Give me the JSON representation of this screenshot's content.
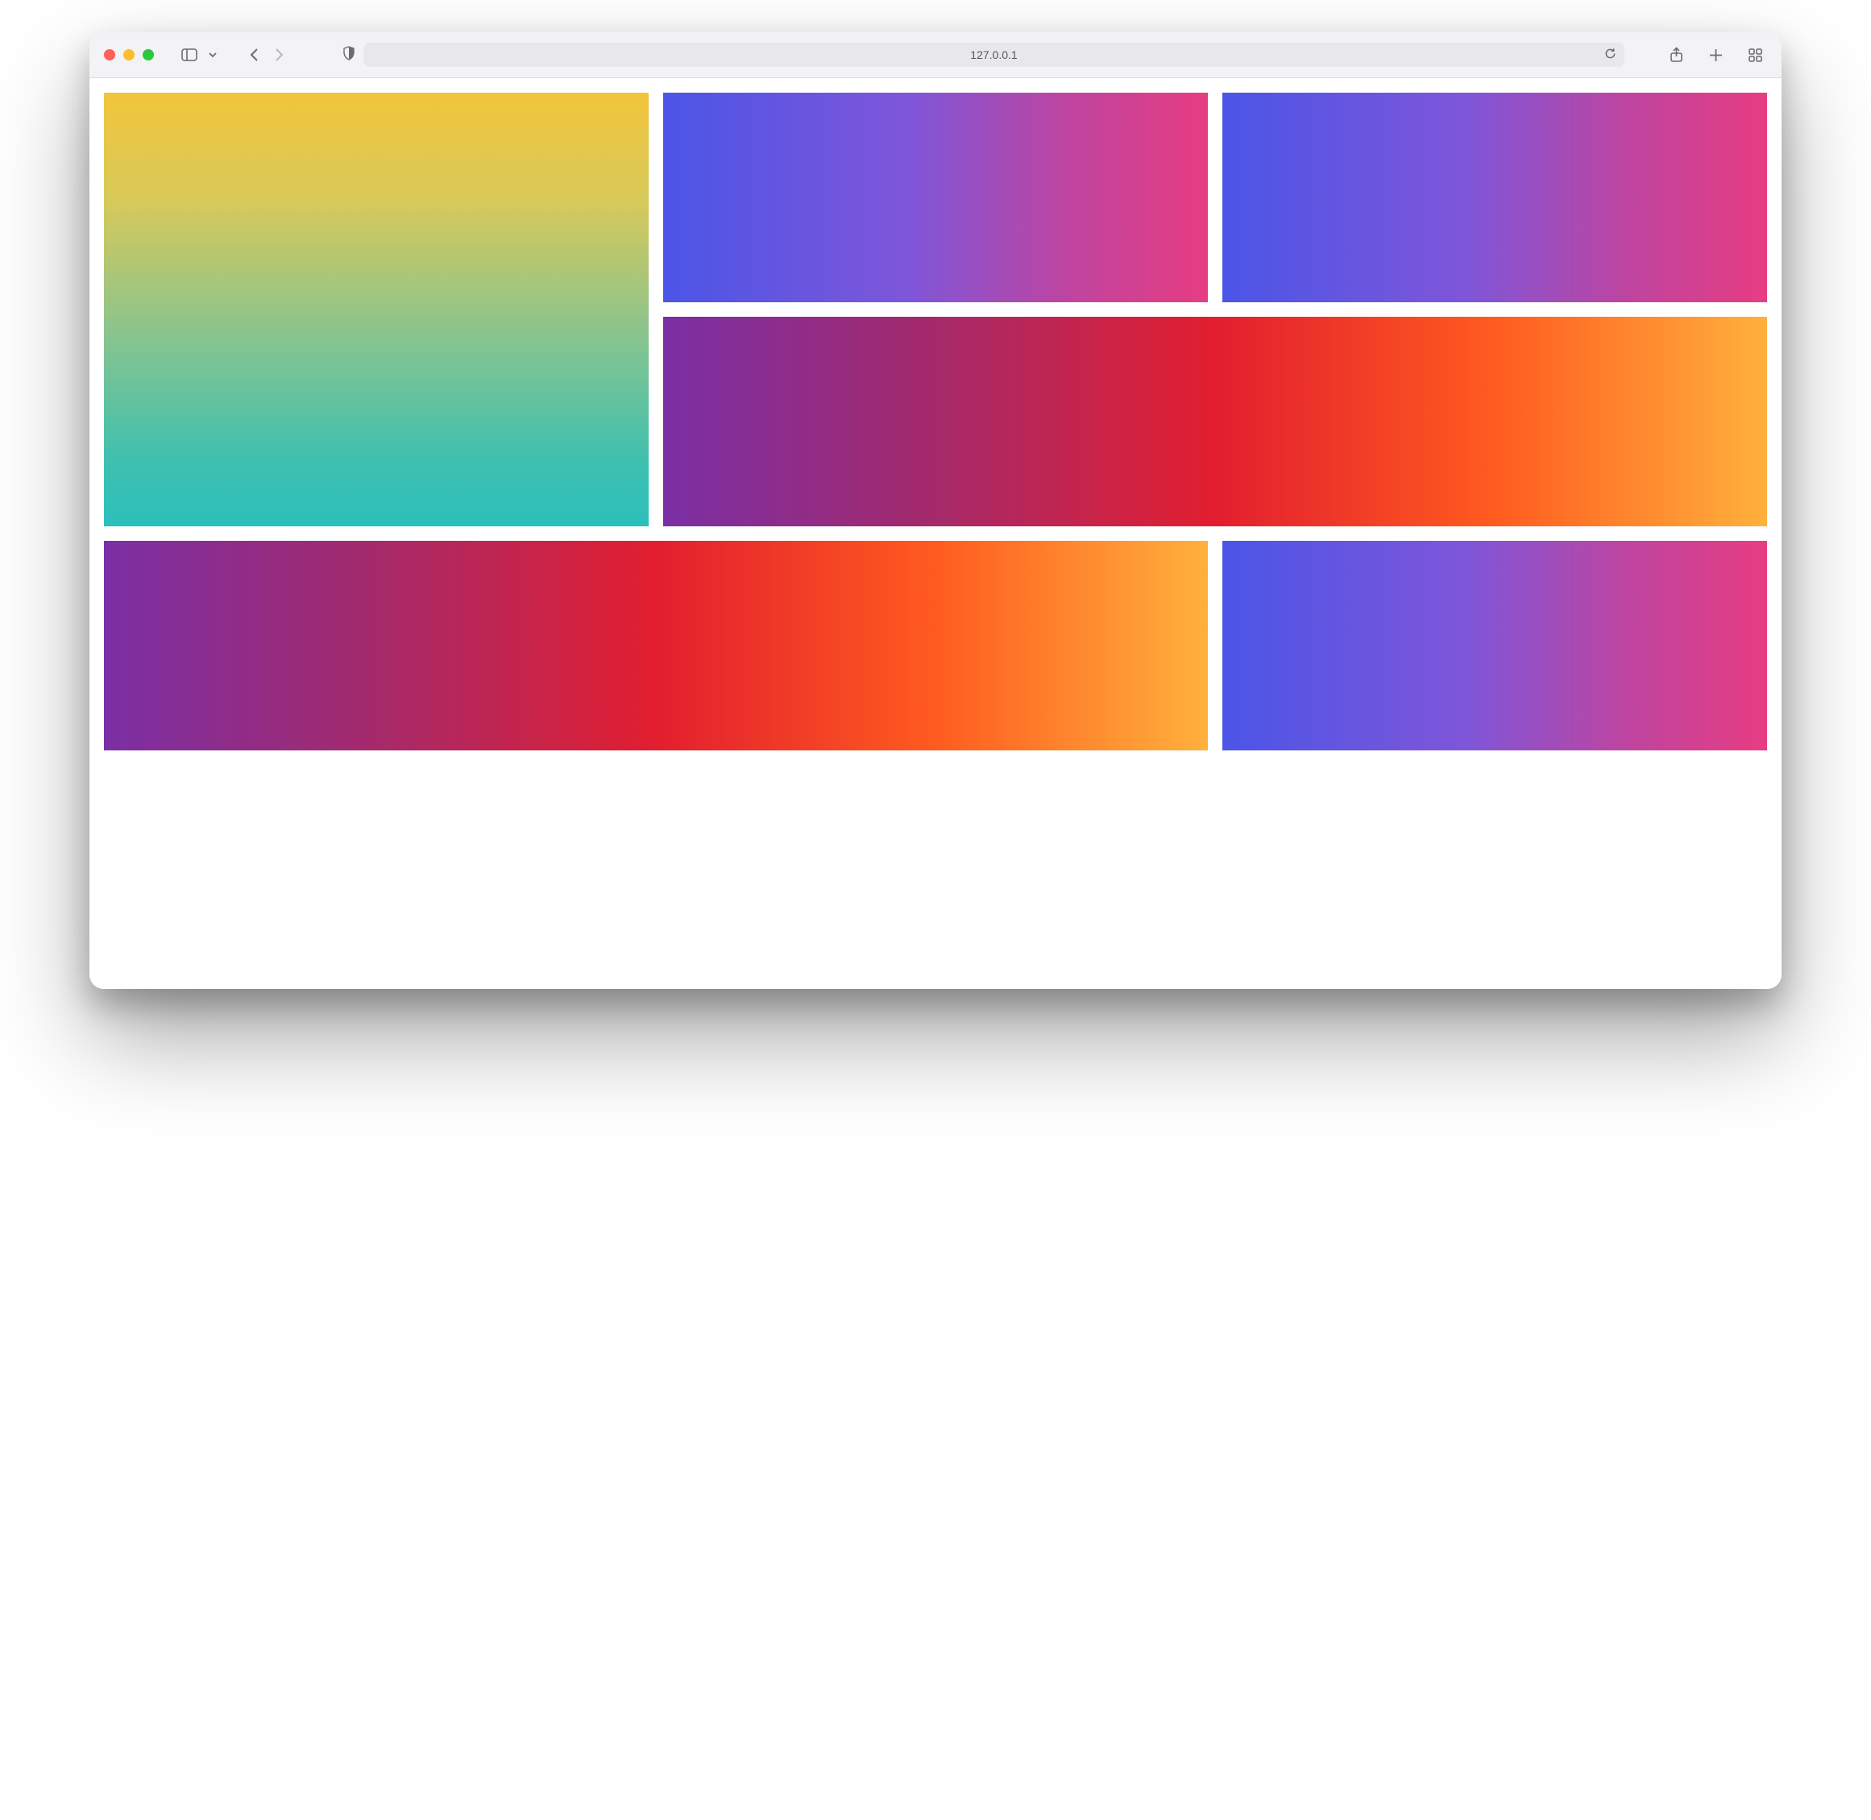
{
  "browser": {
    "address": "127.0.0.1"
  },
  "gradients": {
    "a": {
      "direction": "180deg",
      "stops": [
        "#f2c53b",
        "#d7c95a",
        "#8bc48d",
        "#3fc0b0",
        "#2bc0bb"
      ]
    },
    "b": {
      "direction": "90deg",
      "stops": [
        "#4b55e7",
        "#7f56d9",
        "#c0449f",
        "#e73d82"
      ]
    },
    "c": {
      "direction": "90deg",
      "stops": [
        "#4b55e7",
        "#7f56d9",
        "#c0449f",
        "#e73d82"
      ]
    },
    "d": {
      "direction": "90deg",
      "stops": [
        "#7b2fa5",
        "#a62a6a",
        "#e21e2f",
        "#ff5a1f",
        "#ffb13c"
      ]
    },
    "e": {
      "direction": "90deg",
      "stops": [
        "#7b2fa5",
        "#a62a6a",
        "#e21e2f",
        "#ff5a1f",
        "#ffb13c"
      ]
    },
    "f": {
      "direction": "90deg",
      "stops": [
        "#4b55e7",
        "#7f56d9",
        "#c0449f",
        "#e73d82"
      ]
    }
  }
}
